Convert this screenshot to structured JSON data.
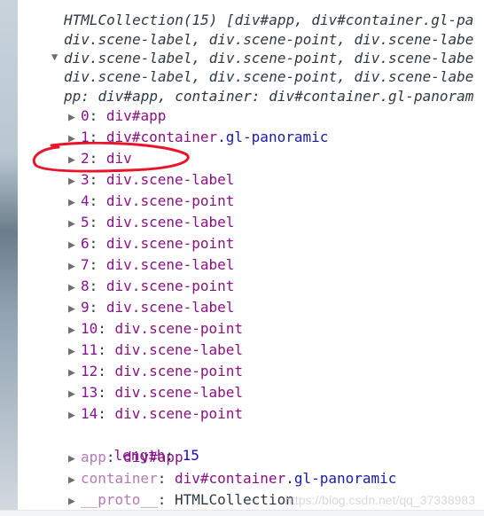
{
  "summary": {
    "lines": [
      "HTMLCollection(15) [div#app, div#container.gl-pa",
      "div.scene-label, div.scene-point, div.scene-labe",
      "div.scene-label, div.scene-point, div.scene-labe",
      "div.scene-label, div.scene-point, div.scene-labe",
      "pp: div#app, container: div#container.gl-panoram"
    ]
  },
  "items": [
    {
      "key": "0",
      "node": "div#app",
      "cls": ""
    },
    {
      "key": "1",
      "node": "div#container",
      "cls": ".gl-panoramic"
    },
    {
      "key": "2",
      "node": "div",
      "cls": ""
    },
    {
      "key": "3",
      "node": "div.scene-label",
      "cls": ""
    },
    {
      "key": "4",
      "node": "div.scene-point",
      "cls": ""
    },
    {
      "key": "5",
      "node": "div.scene-label",
      "cls": ""
    },
    {
      "key": "6",
      "node": "div.scene-point",
      "cls": ""
    },
    {
      "key": "7",
      "node": "div.scene-label",
      "cls": ""
    },
    {
      "key": "8",
      "node": "div.scene-point",
      "cls": ""
    },
    {
      "key": "9",
      "node": "div.scene-label",
      "cls": ""
    },
    {
      "key": "10",
      "node": "div.scene-point",
      "cls": ""
    },
    {
      "key": "11",
      "node": "div.scene-label",
      "cls": ""
    },
    {
      "key": "12",
      "node": "div.scene-point",
      "cls": ""
    },
    {
      "key": "13",
      "node": "div.scene-label",
      "cls": ""
    },
    {
      "key": "14",
      "node": "div.scene-point",
      "cls": ""
    }
  ],
  "length": {
    "key": "length",
    "value": "15"
  },
  "props": [
    {
      "key": "app",
      "node": "div#app",
      "cls": ""
    },
    {
      "key": "container",
      "node": "div#container",
      "cls": ".gl-panoramic"
    },
    {
      "key": "__proto__",
      "node": "HTMLCollection",
      "cls": ""
    }
  ],
  "watermark": "https://blog.csdn.net/qq_37338983",
  "annotation_color": "#e8142a"
}
